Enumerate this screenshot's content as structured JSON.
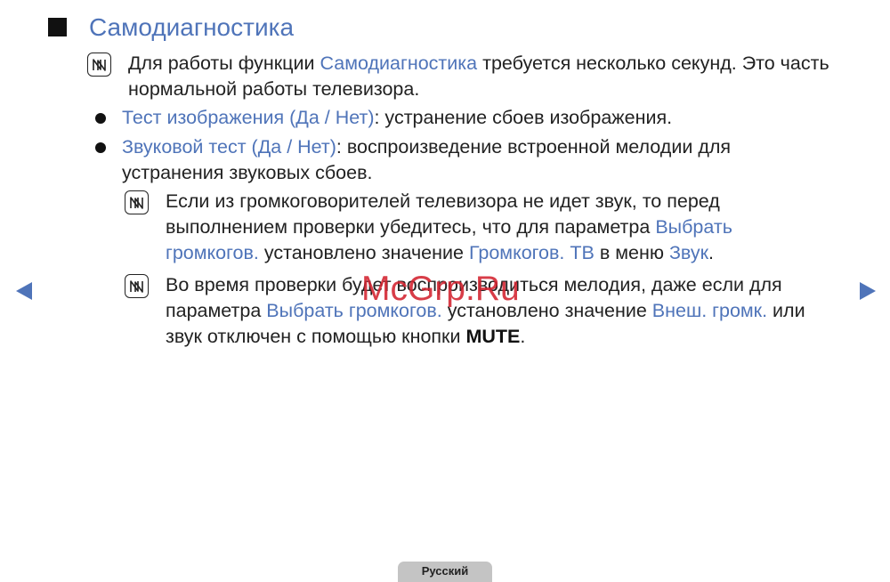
{
  "title": "Самодиагностика",
  "note1": {
    "t1": "Для работы функции ",
    "hl1": "Самодиагностика",
    "t2": " требуется несколько секунд. Это часть нормальной работы телевизора."
  },
  "bullet1": {
    "hl1": "Тест изображения (Да / Нет)",
    "t1": ": устранение сбоев изображения."
  },
  "bullet2": {
    "hl1": "Звуковой тест (Да / Нет)",
    "t1": ": воспроизведение встроенной мелодии для устранения звуковых сбоев."
  },
  "note2": {
    "t1": "Если из громкоговорителей телевизора не идет звук, то перед выполнением проверки убедитесь, что для параметра ",
    "hl1": "Выбрать громкогов.",
    "t2": " установлено значение ",
    "hl2": "Громкогов. ТВ",
    "t3": " в меню ",
    "hl3": "Звук",
    "t4": "."
  },
  "note3": {
    "t1": "Во время проверки будет воспроизводиться мелодия, даже если для параметра ",
    "hl1": "Выбрать громкогов.",
    "t2": " установлено значение ",
    "hl2": "Внеш. громк.",
    "t3": " или звук отключен с помощью кнопки ",
    "strong1": "MUTE",
    "t4": "."
  },
  "watermark": "McGrp.Ru",
  "footer": {
    "language_tab": "Русский"
  },
  "colors": {
    "accent": "#4f74b9",
    "text": "#222222",
    "watermark": "#d3232f",
    "tab_background": "#c4c4c4"
  },
  "icons": {
    "title_marker": "black-square-icon",
    "note": "note-icon",
    "bullet": "bullet-dot-icon",
    "prev": "arrow-left-icon",
    "next": "arrow-right-icon"
  }
}
